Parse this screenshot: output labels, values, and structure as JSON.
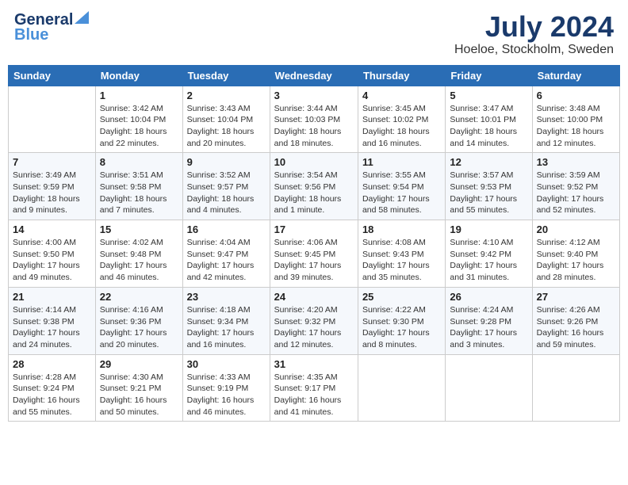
{
  "header": {
    "logo_line1": "General",
    "logo_line2": "Blue",
    "month_title": "July 2024",
    "location": "Hoeloe, Stockholm, Sweden"
  },
  "weekdays": [
    "Sunday",
    "Monday",
    "Tuesday",
    "Wednesday",
    "Thursday",
    "Friday",
    "Saturday"
  ],
  "weeks": [
    [
      {
        "day": "",
        "info": ""
      },
      {
        "day": "1",
        "info": "Sunrise: 3:42 AM\nSunset: 10:04 PM\nDaylight: 18 hours\nand 22 minutes."
      },
      {
        "day": "2",
        "info": "Sunrise: 3:43 AM\nSunset: 10:04 PM\nDaylight: 18 hours\nand 20 minutes."
      },
      {
        "day": "3",
        "info": "Sunrise: 3:44 AM\nSunset: 10:03 PM\nDaylight: 18 hours\nand 18 minutes."
      },
      {
        "day": "4",
        "info": "Sunrise: 3:45 AM\nSunset: 10:02 PM\nDaylight: 18 hours\nand 16 minutes."
      },
      {
        "day": "5",
        "info": "Sunrise: 3:47 AM\nSunset: 10:01 PM\nDaylight: 18 hours\nand 14 minutes."
      },
      {
        "day": "6",
        "info": "Sunrise: 3:48 AM\nSunset: 10:00 PM\nDaylight: 18 hours\nand 12 minutes."
      }
    ],
    [
      {
        "day": "7",
        "info": "Sunrise: 3:49 AM\nSunset: 9:59 PM\nDaylight: 18 hours\nand 9 minutes."
      },
      {
        "day": "8",
        "info": "Sunrise: 3:51 AM\nSunset: 9:58 PM\nDaylight: 18 hours\nand 7 minutes."
      },
      {
        "day": "9",
        "info": "Sunrise: 3:52 AM\nSunset: 9:57 PM\nDaylight: 18 hours\nand 4 minutes."
      },
      {
        "day": "10",
        "info": "Sunrise: 3:54 AM\nSunset: 9:56 PM\nDaylight: 18 hours\nand 1 minute."
      },
      {
        "day": "11",
        "info": "Sunrise: 3:55 AM\nSunset: 9:54 PM\nDaylight: 17 hours\nand 58 minutes."
      },
      {
        "day": "12",
        "info": "Sunrise: 3:57 AM\nSunset: 9:53 PM\nDaylight: 17 hours\nand 55 minutes."
      },
      {
        "day": "13",
        "info": "Sunrise: 3:59 AM\nSunset: 9:52 PM\nDaylight: 17 hours\nand 52 minutes."
      }
    ],
    [
      {
        "day": "14",
        "info": "Sunrise: 4:00 AM\nSunset: 9:50 PM\nDaylight: 17 hours\nand 49 minutes."
      },
      {
        "day": "15",
        "info": "Sunrise: 4:02 AM\nSunset: 9:48 PM\nDaylight: 17 hours\nand 46 minutes."
      },
      {
        "day": "16",
        "info": "Sunrise: 4:04 AM\nSunset: 9:47 PM\nDaylight: 17 hours\nand 42 minutes."
      },
      {
        "day": "17",
        "info": "Sunrise: 4:06 AM\nSunset: 9:45 PM\nDaylight: 17 hours\nand 39 minutes."
      },
      {
        "day": "18",
        "info": "Sunrise: 4:08 AM\nSunset: 9:43 PM\nDaylight: 17 hours\nand 35 minutes."
      },
      {
        "day": "19",
        "info": "Sunrise: 4:10 AM\nSunset: 9:42 PM\nDaylight: 17 hours\nand 31 minutes."
      },
      {
        "day": "20",
        "info": "Sunrise: 4:12 AM\nSunset: 9:40 PM\nDaylight: 17 hours\nand 28 minutes."
      }
    ],
    [
      {
        "day": "21",
        "info": "Sunrise: 4:14 AM\nSunset: 9:38 PM\nDaylight: 17 hours\nand 24 minutes."
      },
      {
        "day": "22",
        "info": "Sunrise: 4:16 AM\nSunset: 9:36 PM\nDaylight: 17 hours\nand 20 minutes."
      },
      {
        "day": "23",
        "info": "Sunrise: 4:18 AM\nSunset: 9:34 PM\nDaylight: 17 hours\nand 16 minutes."
      },
      {
        "day": "24",
        "info": "Sunrise: 4:20 AM\nSunset: 9:32 PM\nDaylight: 17 hours\nand 12 minutes."
      },
      {
        "day": "25",
        "info": "Sunrise: 4:22 AM\nSunset: 9:30 PM\nDaylight: 17 hours\nand 8 minutes."
      },
      {
        "day": "26",
        "info": "Sunrise: 4:24 AM\nSunset: 9:28 PM\nDaylight: 17 hours\nand 3 minutes."
      },
      {
        "day": "27",
        "info": "Sunrise: 4:26 AM\nSunset: 9:26 PM\nDaylight: 16 hours\nand 59 minutes."
      }
    ],
    [
      {
        "day": "28",
        "info": "Sunrise: 4:28 AM\nSunset: 9:24 PM\nDaylight: 16 hours\nand 55 minutes."
      },
      {
        "day": "29",
        "info": "Sunrise: 4:30 AM\nSunset: 9:21 PM\nDaylight: 16 hours\nand 50 minutes."
      },
      {
        "day": "30",
        "info": "Sunrise: 4:33 AM\nSunset: 9:19 PM\nDaylight: 16 hours\nand 46 minutes."
      },
      {
        "day": "31",
        "info": "Sunrise: 4:35 AM\nSunset: 9:17 PM\nDaylight: 16 hours\nand 41 minutes."
      },
      {
        "day": "",
        "info": ""
      },
      {
        "day": "",
        "info": ""
      },
      {
        "day": "",
        "info": ""
      }
    ]
  ]
}
